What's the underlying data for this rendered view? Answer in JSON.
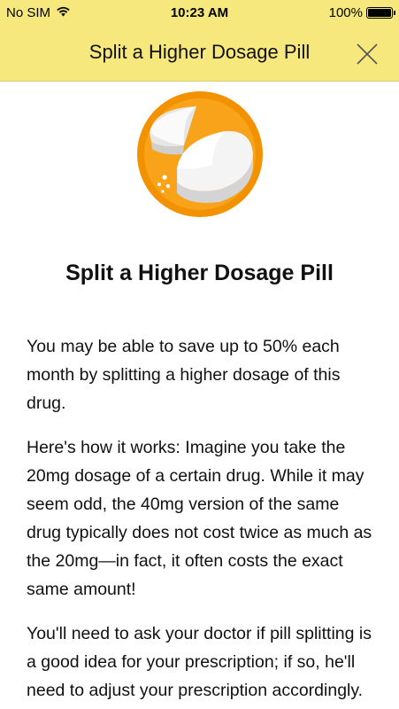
{
  "status_bar": {
    "carrier": "No SIM",
    "time": "10:23 AM",
    "battery": "100%",
    "wifi_icon": "wifi-icon",
    "battery_icon": "battery-icon"
  },
  "nav": {
    "title": "Split a Higher Dosage Pill",
    "close_icon": "close-icon"
  },
  "hero": {
    "icon": "split-pill-icon",
    "colors": {
      "circle_outer": "#f39200",
      "circle_inner": "#f8a31a",
      "pill": "#f2f2f2"
    }
  },
  "content": {
    "heading": "Split a Higher Dosage Pill",
    "paragraphs": [
      "You may be able to save up to 50% each month by splitting a higher dosage of this drug.",
      "Here's how it works: Imagine you take the 20mg dosage of a certain drug. While it may seem odd, the 40mg version of the same drug typically does not cost twice as much as the 20mg—in fact, it often costs the exact same amount!",
      "You'll need to ask your doctor if pill splitting is a good idea for your prescription; if so, he'll need to adjust your prescription accordingly."
    ]
  },
  "theme": {
    "header_background": "#f7e87e",
    "text_color": "#111111"
  }
}
